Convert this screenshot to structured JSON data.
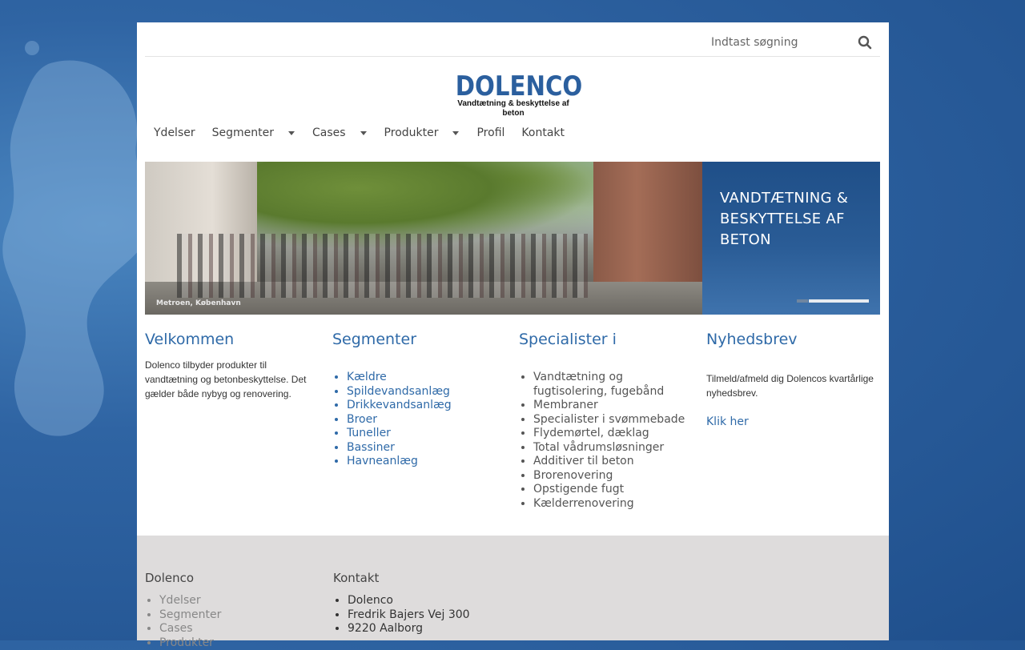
{
  "search": {
    "placeholder": "Indtast søgning"
  },
  "logo": {
    "name": "DOLENCO",
    "tagline": "Vandtætning & beskyttelse af beton"
  },
  "nav": {
    "items": [
      {
        "label": "Ydelser",
        "has_dropdown": false
      },
      {
        "label": "Segmenter",
        "has_dropdown": true
      },
      {
        "label": "Cases",
        "has_dropdown": true
      },
      {
        "label": "Produkter",
        "has_dropdown": true
      },
      {
        "label": "Profil",
        "has_dropdown": false
      },
      {
        "label": "Kontakt",
        "has_dropdown": false
      }
    ]
  },
  "slider": {
    "photo_caption": "Metroen, København",
    "banner_text": "VANDTÆTNING & BESKYTTELSE AF BETON",
    "active_slide": 2,
    "slide_count": 2
  },
  "welcome": {
    "title": "Velkommen",
    "text": "Dolenco tilbyder produkter til vandtætning og betonbeskyttelse. Det gælder både nybyg og renovering."
  },
  "segments": {
    "title": "Segmenter",
    "items": [
      "Kældre",
      "Spildevandsanlæg",
      "Drikkevandsanlæg",
      "Broer",
      "Tuneller",
      "Bassiner",
      "Havneanlæg"
    ]
  },
  "specialists": {
    "title": "Specialister i",
    "items": [
      "Vandtætning og fugtisolering, fugebånd",
      "Membraner",
      "Specialister i svømmebade",
      "Flydemørtel, dæklag",
      "Total vådrumsløsninger",
      "Additiver til beton",
      "Brorenovering",
      "Opstigende fugt",
      "Kælderrenovering"
    ]
  },
  "newsletter": {
    "title": "Nyhedsbrev",
    "text": "Tilmeld/afmeld dig Dolencos kvartårlige nyhedsbrev.",
    "link": "Klik her"
  },
  "footer": {
    "col1": {
      "title": "Dolenco",
      "items": [
        "Ydelser",
        "Segmenter",
        "Cases",
        "Produkter"
      ]
    },
    "col2": {
      "title": "Kontakt",
      "items": [
        "Dolenco",
        "Fredrik Bajers Vej 300",
        "9220 Aalborg"
      ]
    }
  },
  "colors": {
    "accent": "#2f6aa8",
    "logo_blue": "#2b5f9e",
    "background": "#2f64a3",
    "footer_bg": "#dedcdc"
  }
}
